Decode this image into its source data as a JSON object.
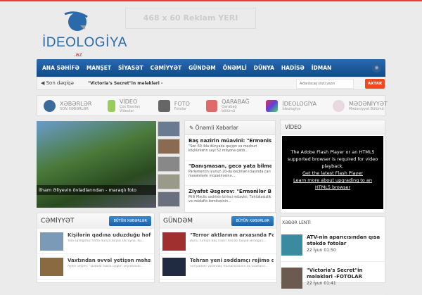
{
  "logo": {
    "name": "İDEOLOGİYA",
    "tld": ".az"
  },
  "ad": "468 x 60 Reklam YERI",
  "nav": [
    "ANA SƏHİFƏ",
    "MANŞET",
    "SİYASƏT",
    "CƏMİYYƏT",
    "GÜNDƏM",
    "ÖNƏMLİ",
    "DÜNYA",
    "HADİSƏ",
    "İDMAN"
  ],
  "breaking": {
    "label": "Son dəqiqə",
    "ticker": "\"Victoria's Secret\"in mələkləri -",
    "search_placeholder": "Axtarılacaq sözü yazın",
    "search_button": "AXTAR"
  },
  "categories": [
    {
      "title": "XƏBƏRLƏR",
      "sub": "SON XƏBƏRLƏR",
      "color": "#3a6a9a"
    },
    {
      "title": "VİDEO",
      "sub": "Çox Baxılan Videolar",
      "color": "#9acc5a"
    },
    {
      "title": "FOTO",
      "sub": "Fotolar",
      "color": "#666"
    },
    {
      "title": "QARABAĞ",
      "sub": "Qarabağ bölümü",
      "color": "#e06a6a"
    },
    {
      "title": "İDEOLOGİYA",
      "sub": "İdeologiya",
      "color": "#a050c0"
    },
    {
      "title": "MƏDƏNİYYƏT",
      "sub": "Mədəniyyət Bölümü",
      "color": "#d8c0d0"
    }
  ],
  "slider": {
    "caption": "İlham Əliyevin övladlarından - maraqlı foto"
  },
  "important": {
    "title": "Önəmli Xəbərlər",
    "items": [
      {
        "h": "Baş nazirin müavini: \"Ermənistan t...",
        "d": "\"Son 60 ilda dünyada qaçqın və məcburi köçkünlərin sayı 52 milyona çatıb..."
      },
      {
        "h": "\"Danışmasan, gecə yata bilməzsə...",
        "d": "Parlamentin iyunun 20-da keçirilən iclasında cari məsələlərin müzakirəsinə..."
      },
      {
        "h": "Ziyafət Əsgərov: \"Ermənilər Bakıda...",
        "d": "Milli Məclis sədrinin birinci müavini, Təhlükəsizlik və müdafiə komitəsinin..."
      }
    ]
  },
  "video": {
    "title": "VİDEO",
    "line1": "The Adobe Flash Player or an HTML5 supported browser is required for video playback.",
    "link1": "Get the latest Flash Player",
    "link2": "Learn more about upgrading to an HTML5 browser"
  },
  "cemiyyet": {
    "title": "CƏMİYYƏT",
    "all": "BÜTÜN XƏBƏRLƏR",
    "items": [
      {
        "h": "Kişilərin qadına uduzduğu həftə - K.",
        "d": "Yola saldığımız həftə dünya birjası Ukrayna, Ru..."
      },
      {
        "h": "Vaxtından əvvəl yetişən məhsullar..",
        "d": "Aydın Əliyev: \"Qidalar fasilə uyğun yeyilməlidi..."
      }
    ]
  },
  "gundem": {
    "title": "GÜNDƏM",
    "all": "BÜTÜN XƏBƏRLƏR",
    "items": [
      {
        "h": "\"Terror aktlarının arxasında Fətul...",
        "d": "Bunu Türkiyə baş naziri Rəcəb Tayyib Ərdoğan..."
      },
      {
        "h": "Tehran yeni səddamçı rejimə qarşı...",
        "d": "Suriyadakı vətəndaş müharibəsinin ilk vaxtların..."
      }
    ]
  },
  "feed": {
    "title": "XƏBƏR LENTİ",
    "items": [
      {
        "h": "ATV-nin aparıcısından qısa ətəkdə fotolar",
        "t": "22 İyun 01:50"
      },
      {
        "h": "\"Victoria's Secret\"in mələkləri -FOTOLAR",
        "t": "22 İyun 01:41"
      }
    ]
  }
}
